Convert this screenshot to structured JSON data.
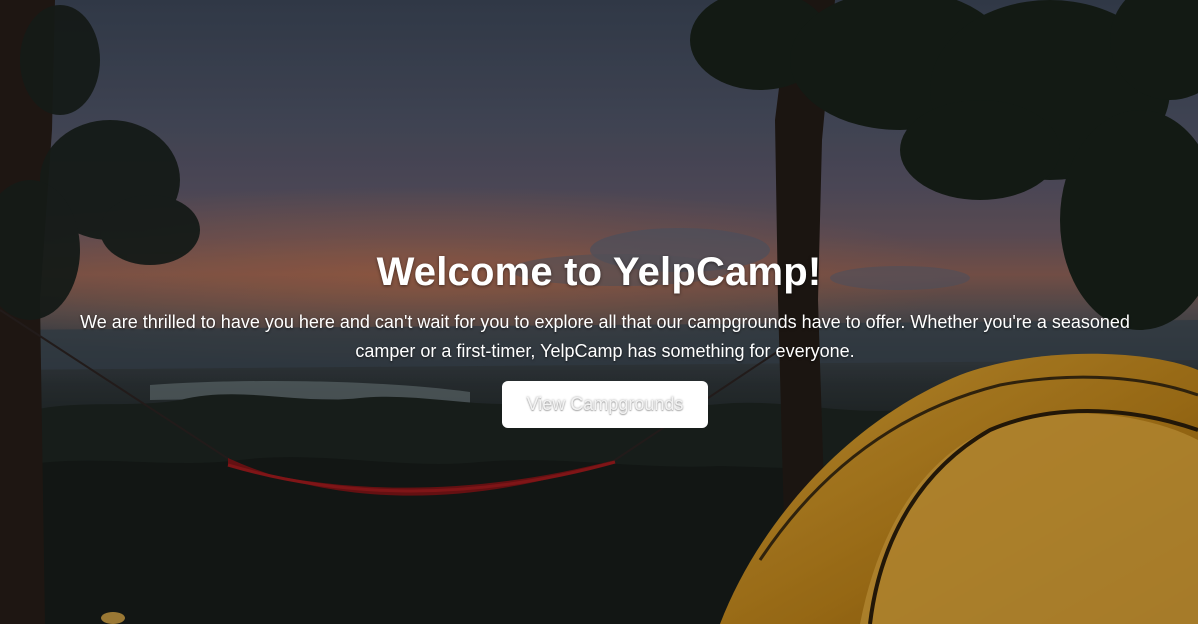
{
  "hero": {
    "title": "Welcome to YelpCamp!",
    "lead": "We are thrilled to have you here and can't wait for you to explore all that our campgrounds have to offer. Whether you're a seasoned camper or a first-timer, YelpCamp has something for everyone.",
    "button_label": "View Campgrounds"
  },
  "colors": {
    "text": "#ffffff",
    "button_bg": "#ffffff",
    "tent": "#c98f1e",
    "hammock": "#7a1416"
  }
}
